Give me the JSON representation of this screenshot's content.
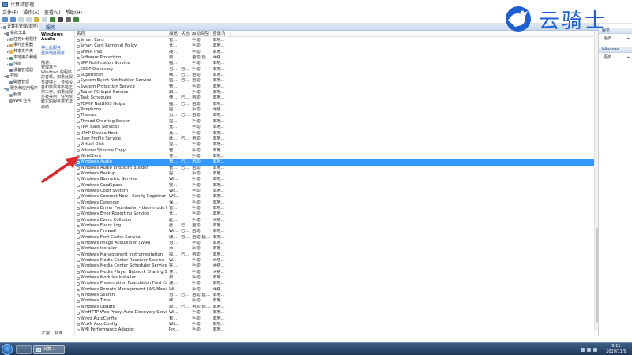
{
  "window": {
    "title": "计算机管理"
  },
  "menu": [
    "文件(F)",
    "操作(A)",
    "查看(V)",
    "帮助(H)"
  ],
  "tree": [
    {
      "label": "计算机管理(本地)",
      "ex": "▾",
      "indent": 0,
      "color": "#5a8fc8"
    },
    {
      "label": "系统工具",
      "ex": "▾",
      "indent": 1,
      "color": "#7a8a9a"
    },
    {
      "label": "任务计划程序",
      "ex": "▸",
      "indent": 2,
      "color": "#9aa9b8"
    },
    {
      "label": "事件查看器",
      "ex": "▸",
      "indent": 2,
      "color": "#c9a14a"
    },
    {
      "label": "共享文件夹",
      "ex": "▸",
      "indent": 2,
      "color": "#e1b84a"
    },
    {
      "label": "本地用户和组",
      "ex": "▸",
      "indent": 2,
      "color": "#4a8f5a"
    },
    {
      "label": "性能",
      "ex": "▸",
      "indent": 2,
      "color": "#6a8fbf"
    },
    {
      "label": "设备管理器",
      "ex": "",
      "indent": 2,
      "color": "#7a7a9a"
    },
    {
      "label": "存储",
      "ex": "▾",
      "indent": 1,
      "color": "#8a8a8a"
    },
    {
      "label": "磁盘管理",
      "ex": "",
      "indent": 2,
      "color": "#7a8aa0"
    },
    {
      "label": "服务和应用程序",
      "ex": "▾",
      "indent": 1,
      "color": "#7aa0c0"
    },
    {
      "label": "服务",
      "ex": "",
      "indent": 2,
      "color": "#8a9aaa"
    },
    {
      "label": "WMI 控件",
      "ex": "",
      "indent": 2,
      "color": "#9a9aaa"
    }
  ],
  "services_header": "服务",
  "desc": {
    "title": "Windows Audio",
    "stop_link": "停止此服务",
    "restart_link": "重启动此服务",
    "desc_label": "描述:",
    "desc_text": "管理基于 Windows 的程序的音频。如果此服务被停止，音频设备和效果将不能正常工作。如果此服务被禁用，任何依赖它的服务将无法启动"
  },
  "columns": [
    "名称",
    "描述",
    "状态",
    "启动类型",
    "登录为"
  ],
  "rows": [
    [
      "Smart Card",
      "管...",
      "",
      "手动",
      "本地..."
    ],
    [
      "Smart Card Removal Policy",
      "允...",
      "",
      "手动",
      "本地..."
    ],
    [
      "SNMP Trap",
      "接...",
      "",
      "手动",
      "本地..."
    ],
    [
      "Software Protection",
      "启...",
      "",
      "自动(延...",
      "网络..."
    ],
    [
      "SPP Notification Service",
      "提...",
      "",
      "手动",
      "本地..."
    ],
    [
      "SSDP Discovery",
      "当...",
      "已...",
      "手动",
      "本地..."
    ],
    [
      "Superfetch",
      "维...",
      "已...",
      "自动",
      "本地..."
    ],
    [
      "System Event Notification Service",
      "监...",
      "已...",
      "自动",
      "本地..."
    ],
    [
      "System Protection Service",
      "管...",
      "",
      "手动",
      "本地..."
    ],
    [
      "Tablet PC Input Service",
      "启...",
      "",
      "手动",
      "本地..."
    ],
    [
      "Task Scheduler",
      "使...",
      "已...",
      "自动",
      "本地..."
    ],
    [
      "TCP/IP NetBIOS Helper",
      "提...",
      "已...",
      "自动",
      "本地..."
    ],
    [
      "Telephony",
      "提...",
      "",
      "手动",
      "网络..."
    ],
    [
      "Themes",
      "为...",
      "已...",
      "自动",
      "本地..."
    ],
    [
      "Thread Ordering Server",
      "提...",
      "",
      "手动",
      "本地..."
    ],
    [
      "TPM Base Services",
      "允...",
      "",
      "手动",
      "本地..."
    ],
    [
      "UPnP Device Host",
      "允...",
      "",
      "手动",
      "本地..."
    ],
    [
      "User Profile Service",
      "此...",
      "已...",
      "自动",
      "本地..."
    ],
    [
      "Virtual Disk",
      "提...",
      "",
      "手动",
      "本地..."
    ],
    [
      "Volume Shadow Copy",
      "管...",
      "",
      "手动",
      "本地..."
    ],
    [
      "WebClient",
      "使...",
      "",
      "手动",
      "本地..."
    ],
    [
      "Windows Audio",
      "管...",
      "已...",
      "自动",
      "本地..."
    ],
    [
      "Windows Audio Endpoint Builder",
      "管...",
      "已...",
      "自动",
      "本地..."
    ],
    [
      "Windows Backup",
      "提...",
      "",
      "手动",
      "本地..."
    ],
    [
      "Windows Biometric Service",
      "Wi...",
      "",
      "手动",
      "本地..."
    ],
    [
      "Windows CardSpace",
      "安...",
      "",
      "手动",
      "本地..."
    ],
    [
      "Windows Color System",
      "Wc...",
      "",
      "手动",
      "本地..."
    ],
    [
      "Windows Connect Now - Config Registrar",
      "WC...",
      "",
      "手动",
      "本地..."
    ],
    [
      "Windows Defender",
      "保...",
      "",
      "手动",
      "本地..."
    ],
    [
      "Windows Driver Foundation - User-mode Dri...",
      "管...",
      "",
      "手动",
      "本地..."
    ],
    [
      "Windows Error Reporting Service",
      "允...",
      "",
      "手动",
      "本地..."
    ],
    [
      "Windows Event Collector",
      "此...",
      "",
      "手动",
      "网络..."
    ],
    [
      "Windows Event Log",
      "此...",
      "已...",
      "自动",
      "本地..."
    ],
    [
      "Windows Firewall",
      "Wi...",
      "已...",
      "自动",
      "本地..."
    ],
    [
      "Windows Font Cache Service",
      "通...",
      "已...",
      "自动(延...",
      "本地..."
    ],
    [
      "Windows Image Acquisition (WIA)",
      "为...",
      "",
      "手动",
      "本地..."
    ],
    [
      "Windows Installer",
      "添...",
      "",
      "手动",
      "本地..."
    ],
    [
      "Windows Management Instrumentation",
      "提...",
      "已...",
      "自动",
      "本地..."
    ],
    [
      "Windows Media Center Receiver Service",
      "W...",
      "",
      "手动",
      "网络..."
    ],
    [
      "Windows Media Center Scheduler Service",
      "在...",
      "",
      "手动",
      "网络..."
    ],
    [
      "Windows Media Player Network Sharing Servi...",
      "使...",
      "",
      "手动",
      "网络..."
    ],
    [
      "Windows Modules Installer",
      "启...",
      "",
      "手动",
      "本地..."
    ],
    [
      "Windows Presentation Foundation Font Cach...",
      "通...",
      "",
      "手动",
      "本地..."
    ],
    [
      "Windows Remote Management (WS-Manage...",
      "Wi...",
      "",
      "手动",
      "网络..."
    ],
    [
      "Windows Search",
      "为...",
      "已...",
      "自动(延...",
      "本地..."
    ],
    [
      "Windows Time",
      "维...",
      "",
      "手动",
      "本地..."
    ],
    [
      "Windows Update",
      "启...",
      "已...",
      "自动(延...",
      "本地..."
    ],
    [
      "WinHTTP Web Proxy Auto-Discovery Service",
      "Wi...",
      "",
      "手动",
      "本地..."
    ],
    [
      "Wired AutoConfig",
      "有...",
      "",
      "手动",
      "本地..."
    ],
    [
      "WLAN AutoConfig",
      "WL...",
      "",
      "手动",
      "本地..."
    ],
    [
      "WMI Performance Adapter",
      "Pro...",
      "",
      "手动",
      "本地..."
    ]
  ],
  "selected_row": 21,
  "tabs": [
    "扩展",
    "标准"
  ],
  "actions": {
    "header1": "服务",
    "more1": "更多...",
    "header2": "Windows ...",
    "more2": "更多..."
  },
  "taskbar": {
    "app_label": "计算...",
    "time": "9:11",
    "date": "2019/11/9"
  },
  "watermark": {
    "text": "云骑士"
  },
  "colors": {
    "selection": "#3399ff",
    "link": "#1a56c4",
    "accent": "#1f5fd4",
    "arrow": "#e0282b"
  }
}
